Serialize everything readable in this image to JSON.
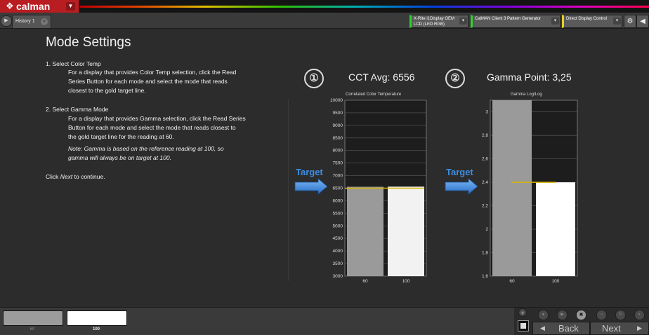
{
  "app": {
    "name": "calman",
    "logo_icon": "calman-diamond-icon"
  },
  "tabs": [
    {
      "label": "History 1"
    }
  ],
  "devices": [
    {
      "line1": "X-Rite i1Display OEM",
      "line2": "LCD (LED RGB)",
      "color": "#2ed02e"
    },
    {
      "line1": "CalMAN Client 3 Pattern Generator",
      "line2": "",
      "color": "#2ed02e"
    },
    {
      "line1": "Direct Display Control",
      "line2": "",
      "color": "#e8d020"
    }
  ],
  "page": {
    "title": "Mode Settings",
    "step1": {
      "heading": "1. Select Color Temp",
      "line1": "For a display that provides Color Temp selection, click the Read",
      "line2": "Series Button for each mode and select the mode that reads",
      "line3": "closest to the gold target line."
    },
    "step2": {
      "heading": "2. Select Gamma Mode",
      "line1": "For a display that provides Gamma selection, click the Read Series",
      "line2": "Button for each mode and select the mode that reads closest to",
      "line3": "the gold target line for the reading at 60.",
      "note1": "Note: Gamma is based on the reference reading at 100, so",
      "note2": "gamma will always be on target at 100."
    },
    "click_prefix": "Click ",
    "click_next": "Next",
    "click_suffix": " to continue."
  },
  "charts": {
    "cct": {
      "number": "①",
      "heading": "CCT Avg: 6556",
      "subtitle": "Correlated Color Temperature",
      "target_label": "Target"
    },
    "gamma": {
      "number": "②",
      "heading": "Gamma Point: 3,25",
      "subtitle": "Gamma Log/Log",
      "target_label": "Target"
    }
  },
  "chart_data": [
    {
      "type": "bar",
      "title": "Correlated Color Temperature",
      "categories": [
        "60",
        "100"
      ],
      "values": [
        6556,
        6560
      ],
      "bar_colors": [
        "#9a9a9a",
        "#f2f2f2"
      ],
      "target": 6500,
      "ylim": [
        3000,
        10000
      ],
      "yticks": [
        "3000",
        "3500",
        "4000",
        "4500",
        "5000",
        "5500",
        "6000",
        "6500",
        "7000",
        "7500",
        "8000",
        "8500",
        "9000",
        "9500",
        "10000"
      ]
    },
    {
      "type": "bar",
      "title": "Gamma Log/Log",
      "categories": [
        "60",
        "100"
      ],
      "values": [
        3.25,
        2.4
      ],
      "bar_colors": [
        "#9a9a9a",
        "#ffffff"
      ],
      "target": 2.4,
      "ylim": [
        1.6,
        3.1
      ],
      "yticks": [
        "1,6",
        "1,8",
        "2",
        "2,2",
        "2,4",
        "2,6",
        "2,8",
        "3"
      ]
    }
  ],
  "bottom": {
    "swatches": [
      {
        "label": "60",
        "color": "#9c9c9c"
      },
      {
        "label": "100",
        "color": "#ffffff"
      }
    ],
    "back_label": "Back",
    "next_label": "Next"
  },
  "colors": {
    "target_line": "#d6b400",
    "arrow": "#3f8ee0"
  }
}
